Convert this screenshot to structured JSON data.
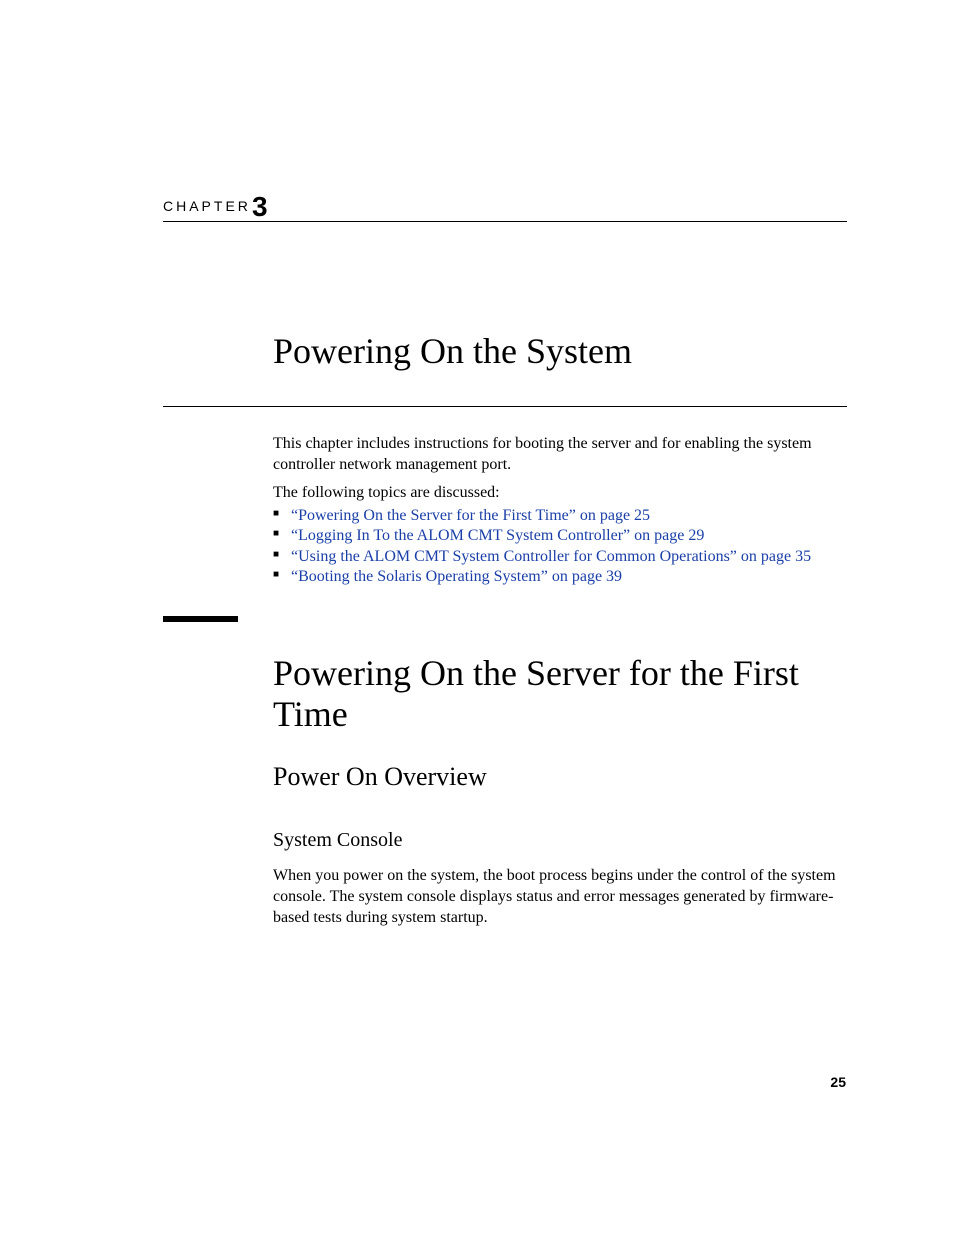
{
  "chapter": {
    "label": "CHAPTER",
    "number": "3",
    "title": "Powering On the System"
  },
  "intro": {
    "p1": "This chapter includes instructions for booting the server and for enabling the system controller network management port.",
    "p2": "The following topics are discussed:"
  },
  "toc": [
    {
      "text": "“Powering On the Server for the First Time” on page 25"
    },
    {
      "text": "“Logging In To the ALOM CMT System Controller” on page 29"
    },
    {
      "text": "“Using the ALOM CMT System Controller for Common Operations” on page 35"
    },
    {
      "text": "“Booting the Solaris Operating System” on page 39"
    }
  ],
  "section": {
    "title": "Powering On the Server for the First Time",
    "subsection": "Power On Overview",
    "subsub": "System Console",
    "body": "When you power on the system, the boot process begins under the control of the system console. The system console displays status and error messages generated by firmware-based tests during system startup."
  },
  "page_number": "25"
}
